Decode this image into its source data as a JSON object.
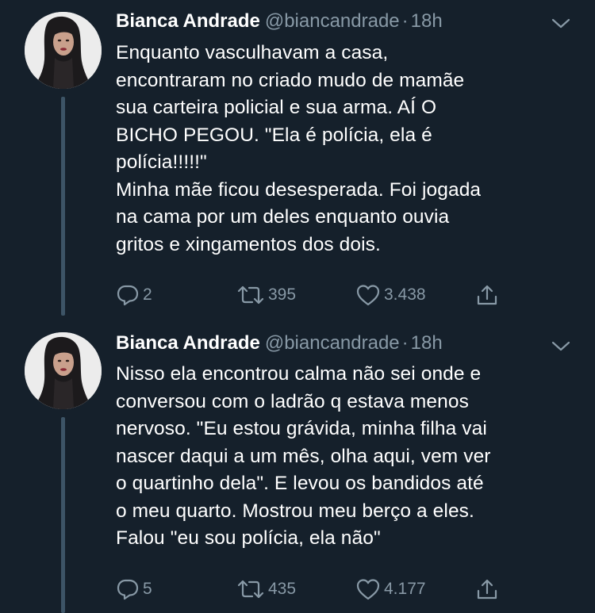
{
  "tweets": [
    {
      "author": "Bianca Andrade",
      "handle": "@biancandrade",
      "separator": "·",
      "time": "18h",
      "text_lines": [
        "Enquanto vasculhavam a casa,",
        "encontraram no criado mudo de mamãe",
        "sua carteira policial e sua arma. AÍ O",
        "BICHO PEGOU. \"Ela é polícia, ela é",
        "polícia!!!!!\"",
        "Minha mãe ficou desesperada. Foi jogada",
        "na cama por um deles enquanto ouvia",
        "gritos e xingamentos dos dois."
      ],
      "replies": "2",
      "retweets": "395",
      "likes": "3.438"
    },
    {
      "author": "Bianca Andrade",
      "handle": "@biancandrade",
      "separator": "·",
      "time": "18h",
      "text_lines": [
        "Nisso ela encontrou calma não sei onde e",
        "conversou com o ladrão q estava menos",
        "nervoso. \"Eu estou grávida, minha filha vai",
        "nascer daqui a um mês, olha aqui, vem ver",
        "o quartinho dela\". E levou os bandidos até",
        "o meu quarto. Mostrou meu berço a eles.",
        "Falou \"eu sou polícia, ela não\""
      ],
      "replies": "5",
      "retweets": "435",
      "likes": "4.177"
    }
  ],
  "icons": {
    "reply": "reply-icon",
    "retweet": "retweet-icon",
    "like": "heart-icon",
    "share": "share-icon",
    "menu": "chevron-down-icon"
  },
  "colors": {
    "background": "#15202b",
    "text": "#ffffff",
    "secondary": "#8899a6",
    "thread_line": "#3d5466"
  }
}
